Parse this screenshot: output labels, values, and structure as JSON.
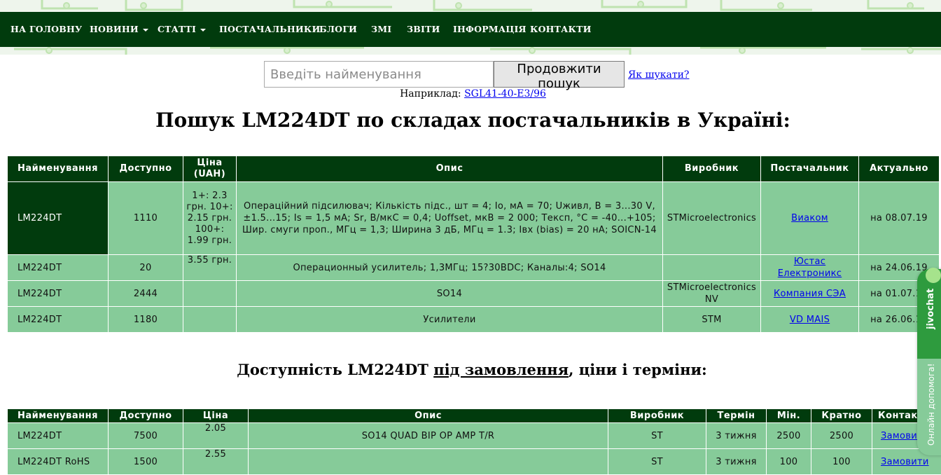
{
  "nav": {
    "items": [
      {
        "label": "НА ГОЛОВНУ",
        "dropdown": false
      },
      {
        "label": "НОВИНИ",
        "dropdown": true
      },
      {
        "label": "СТАТТІ",
        "dropdown": true
      },
      {
        "label": "ПОСТАЧАЛЬНИКИ",
        "dropdown": false
      },
      {
        "label": "БЛОГИ",
        "dropdown": false
      },
      {
        "label": "ЗМІ",
        "dropdown": false
      },
      {
        "label": "ЗВІТИ",
        "dropdown": false
      },
      {
        "label": "ІНФОРМАЦІЯ",
        "dropdown": false
      },
      {
        "label": "КОНТАКТИ",
        "dropdown": false
      }
    ]
  },
  "search": {
    "placeholder": "Введіть найменування",
    "value": "",
    "button_label": "Продовжити пошук",
    "help_link": "Як шукати?",
    "example_prefix": "Наприклад:",
    "example_link": "SGL41-40-E3/96"
  },
  "stock_section": {
    "heading": "Пошук LM224DT по складах постачальників в Україні:",
    "headers": [
      "Найменування",
      "Доступно",
      "Ціна (UAH)",
      "Опис",
      "Виробник",
      "Постачальник",
      "Актуально"
    ],
    "rows": [
      {
        "name": "LM224DT",
        "available": "1110",
        "price": "1+: 2.3 грн. 10+: 2.15 грн. 100+: 1.99 грн.",
        "description": "Операційний підсилювач; Кількість підс., шт = 4; Io, мА = 70; Uживл, В = 3...30 V, ±1.5...15; Is = 1,5 мА; Sr, В/мкС = 0,4; Uoffset, мкВ = 2 000; Tексп, °C = -40...+105; Шир. смуги проп., МГц = 1,3; Ширина 3 дБ, МГц = 1.3; Iвх (bias) = 20 нА; SOICN-14",
        "manufacturer": "STMicroelectronics",
        "supplier": "Виаком",
        "updated": "на 08.07.19"
      },
      {
        "name": "LM224DT",
        "available": "20",
        "price": "3.55 грн.",
        "description": "Операционный усилитель; 1,3МГц; 15?30ВDC; Каналы:4; SO14",
        "manufacturer": "",
        "supplier": "Юстас Електроникс",
        "updated": "на 24.06.19"
      },
      {
        "name": "LM224DT",
        "available": "2444",
        "price": "",
        "description": "SO14",
        "manufacturer": "STMicroelectronics NV",
        "supplier": "Компания СЭА",
        "updated": "на 01.07.19"
      },
      {
        "name": "LM224DT",
        "available": "1180",
        "price": "",
        "description": "Усилители",
        "manufacturer": "STM",
        "supplier": "VD MAIS",
        "updated": "на 26.06.19"
      }
    ]
  },
  "order_section": {
    "heading_prefix": "Доступність LM224DT",
    "heading_link": "під замовлення",
    "heading_suffix": ", ціни і терміни:",
    "headers": [
      "Найменування",
      "Доступно",
      "Ціна",
      "Опис",
      "Виробник",
      "Термін",
      "Мін.",
      "Кратно",
      "Контакти"
    ],
    "rows": [
      {
        "name": "LM224DT",
        "available": "7500",
        "price": "2.05",
        "description": "SO14 QUAD BIP OP AMP T/R",
        "manufacturer": "ST",
        "term": "3 тижня",
        "min": "2500",
        "multiple": "2500",
        "contact": "Замовити"
      },
      {
        "name": "LM224DT RoHS",
        "available": "1500",
        "price": "2.55",
        "description": "",
        "manufacturer": "ST",
        "term": "3 тижня",
        "min": "100",
        "multiple": "100",
        "contact": "Замовити"
      }
    ]
  },
  "chat_widget": {
    "title": "jivochat",
    "subtitle": "Онлайн допомога!"
  }
}
